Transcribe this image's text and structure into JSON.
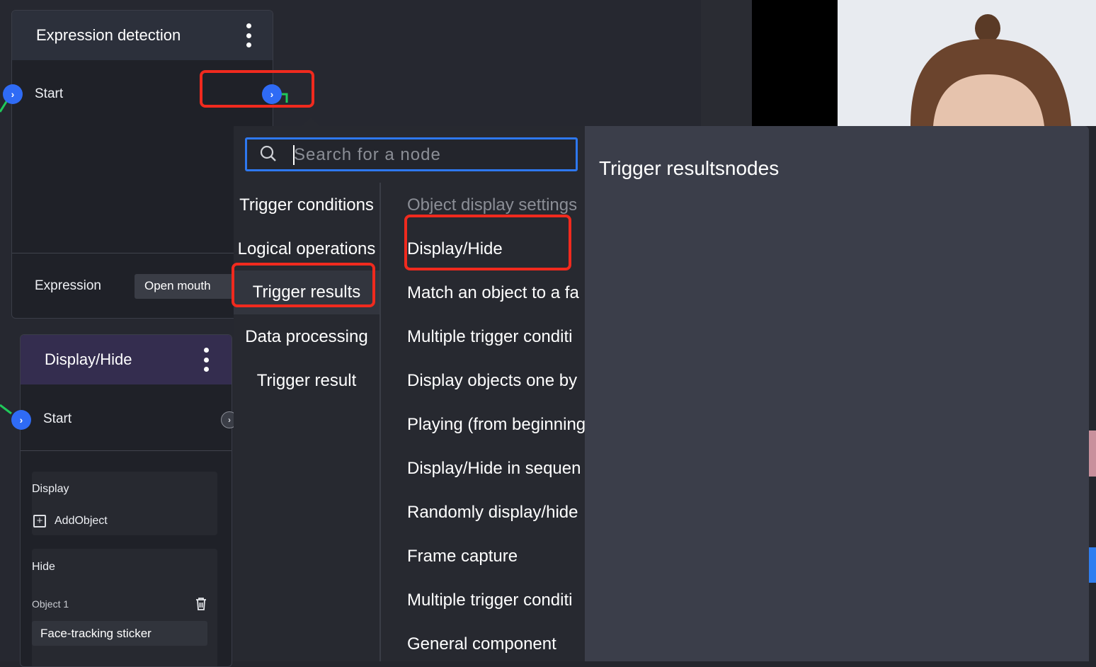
{
  "expression_node": {
    "title": "Expression detection",
    "start_label": "Start",
    "expression_label": "Expression",
    "expression_value": "Open mouth"
  },
  "display_node": {
    "title": "Display/Hide",
    "start_label": "Start",
    "display_section_label": "Display",
    "add_object_label": "AddObject",
    "hide_section_label": "Hide",
    "object_label": "Object 1",
    "object_value": "Face-tracking sticker"
  },
  "node_menu": {
    "search_placeholder": "Search for a node",
    "categories": [
      "Trigger conditions",
      "Logical operations",
      "Trigger results",
      "Data processing",
      "Trigger result"
    ],
    "active_category": "Trigger results",
    "subheading": "Object display settings",
    "items": [
      "Display/Hide",
      "Match an object to a fa",
      "Multiple trigger conditi",
      "Display objects one by",
      "Playing (from beginning",
      "Display/Hide in sequen",
      "Randomly display/hide",
      "Frame capture",
      "Multiple trigger conditi",
      "General component"
    ],
    "detail_title": "Trigger resultsnodes"
  },
  "colors": {
    "accent_blue": "#2f6bf5",
    "highlight_red": "#f02a1e",
    "connector_green": "#1fc95a"
  },
  "icons": [
    "kebab-menu-icon",
    "chevron-right-icon",
    "search-icon",
    "plus-square-icon",
    "trash-icon"
  ]
}
